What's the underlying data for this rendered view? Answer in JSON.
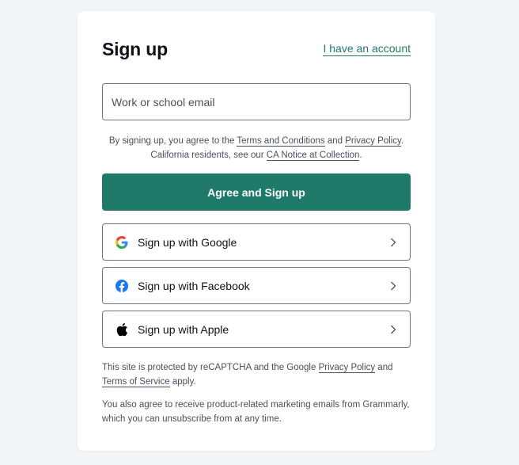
{
  "header": {
    "title": "Sign up",
    "account_link": "I have an account"
  },
  "email": {
    "placeholder": "Work or school email",
    "value": ""
  },
  "terms": {
    "prefix": "By signing up, you agree to the ",
    "terms_link": "Terms and Conditions",
    "and": " and ",
    "privacy_link": "Privacy Policy",
    "period": ".",
    "line2_prefix": "California residents, see our ",
    "ca_link": "CA Notice at Collection",
    "line2_suffix": "."
  },
  "primary_button": {
    "label": "Agree and Sign up",
    "color": "#1f7a6a"
  },
  "social": [
    {
      "label": "Sign up with Google",
      "icon": "google-icon"
    },
    {
      "label": "Sign up with Facebook",
      "icon": "facebook-icon"
    },
    {
      "label": "Sign up with Apple",
      "icon": "apple-icon"
    }
  ],
  "recaptcha": {
    "prefix": "This site is protected by reCAPTCHA and the Google ",
    "privacy_link": "Privacy Policy",
    "and": " and",
    "tos_link": "Terms of Service",
    "suffix": " apply."
  },
  "marketing": {
    "text": "You also agree to receive product-related marketing emails from Grammarly, which you can unsubscribe from at any time."
  },
  "colors": {
    "accent": "#1f7a6a",
    "background": "#f2f4f8",
    "card": "#ffffff",
    "border": "#6d758d"
  }
}
